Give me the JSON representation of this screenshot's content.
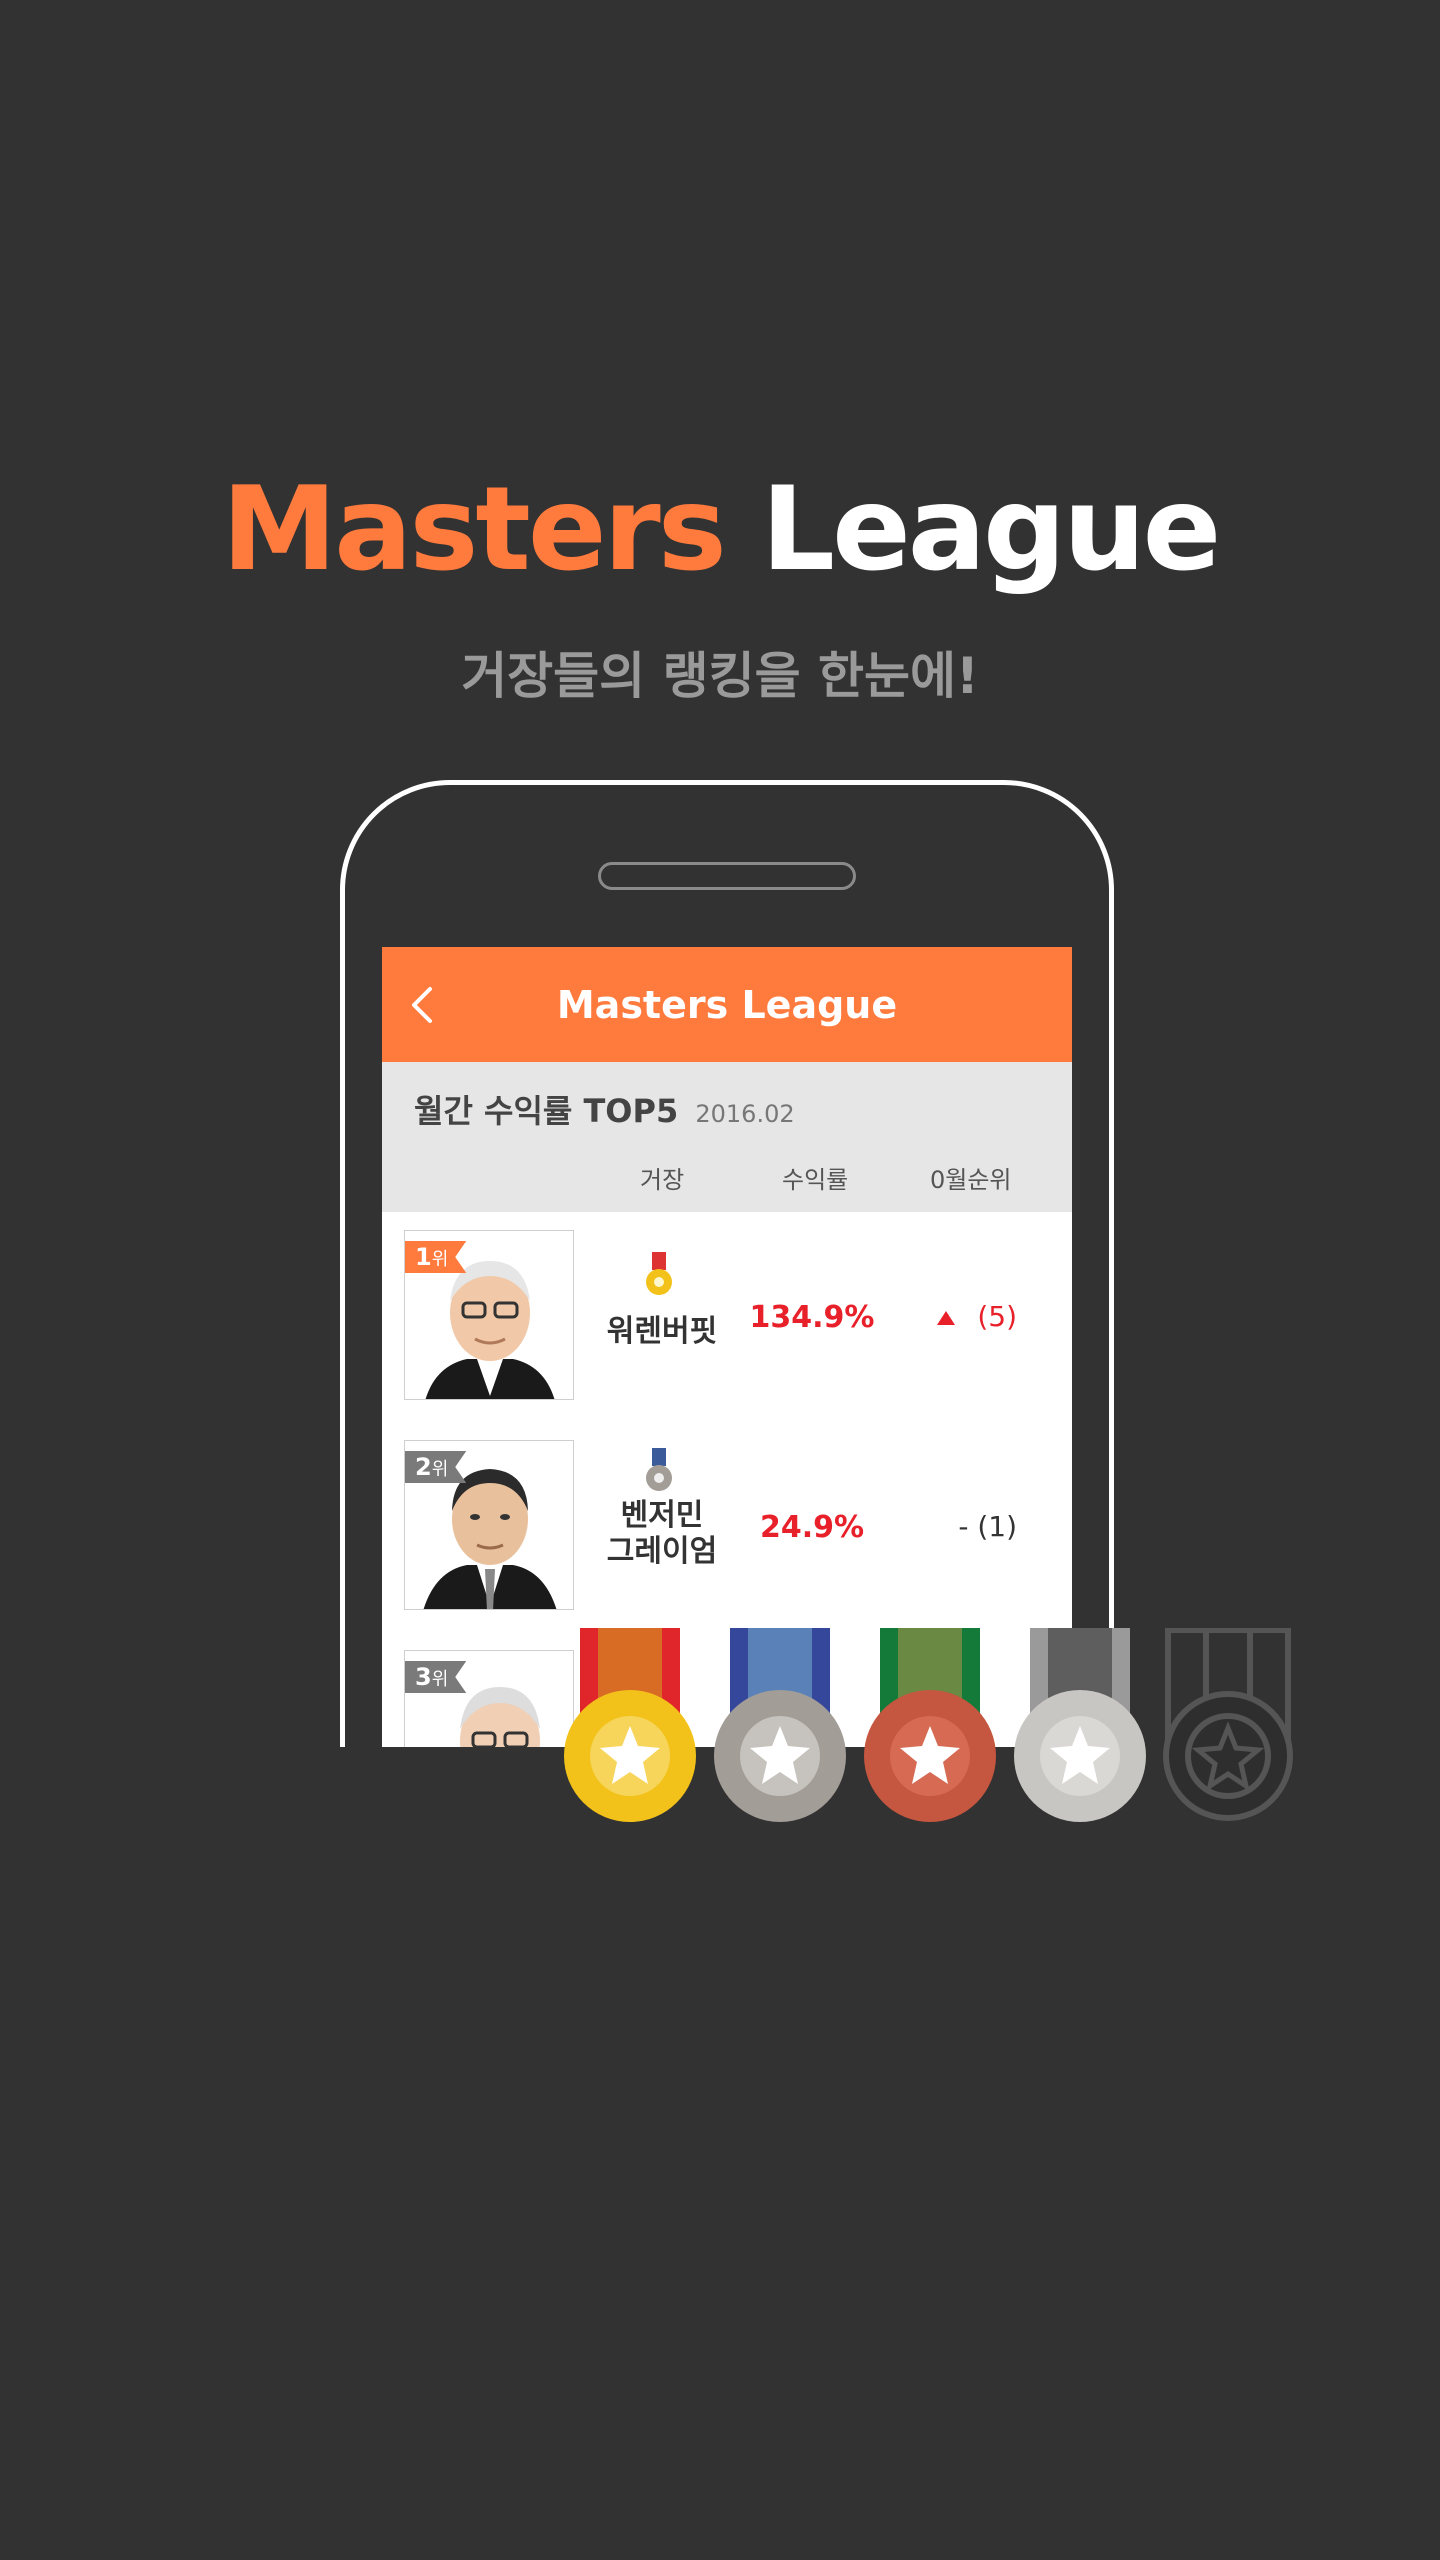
{
  "hero": {
    "title_part1": "Masters",
    "title_part2": "League",
    "subtitle": "거장들의 랭킹을 한눈에!"
  },
  "app": {
    "title": "Masters League",
    "section_title": "월간 수익률 TOP5",
    "section_date": "2016.02",
    "columns": [
      "거장",
      "수익률",
      "0월순위"
    ],
    "rows": [
      {
        "rank": "1",
        "rank_unit": "위",
        "name_line1": "워렌버핏",
        "name_line2": "",
        "rate": "134.9%",
        "change": "(5)",
        "trend": "up",
        "tag_color": "#ff7a3d",
        "medal": "gold"
      },
      {
        "rank": "2",
        "rank_unit": "위",
        "name_line1": "벤저민",
        "name_line2": "그레이엄",
        "rate": "24.9%",
        "change": "- (1)",
        "trend": "none",
        "tag_color": "#7a7a7a",
        "medal": "silver"
      },
      {
        "rank": "3",
        "rank_unit": "위",
        "name_line1": "",
        "name_line2": "",
        "rate": "",
        "change": "",
        "trend": "none",
        "tag_color": "#7a7a7a",
        "medal": "none"
      }
    ]
  },
  "colors": {
    "accent": "#ff7a3d",
    "background": "#323232",
    "rate_red": "#e8202a",
    "medal_gold": "#f3c21a",
    "medal_silver": "#a39d97",
    "medal_bronze": "#c5563f",
    "medal_platinum": "#c8c6c2",
    "medal_outline": "#2e2e2e"
  },
  "icons": [
    "back-chevron-icon",
    "medal-icon",
    "trend-up-icon"
  ]
}
